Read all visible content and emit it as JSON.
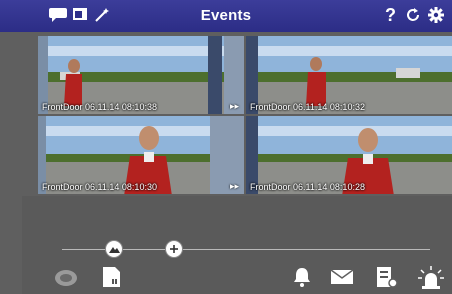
{
  "header": {
    "title": "Events",
    "left_icons": [
      "chat-bubble-icon",
      "window-icon",
      "magic-wand-icon"
    ],
    "right_icons": [
      "help-icon",
      "refresh-icon",
      "settings-gear-icon"
    ],
    "help_glyph": "?"
  },
  "events": [
    {
      "camera": "FrontDoor",
      "date": "06.11.14",
      "time": "08:10:38"
    },
    {
      "camera": "FrontDoor",
      "date": "06.11.14",
      "time": "08:10:32"
    },
    {
      "camera": "FrontDoor",
      "date": "06.11.14",
      "time": "08:10:30"
    },
    {
      "camera": "FrontDoor",
      "date": "06.11.14",
      "time": "08:10:28"
    }
  ],
  "timeline": {
    "controls": [
      "mountain-icon",
      "zoom-in-plus-icon"
    ]
  },
  "bottom_toolbar": {
    "icons": [
      "lens-icon",
      "sd-card-icon",
      "bell-icon",
      "mail-icon",
      "file-transfer-icon",
      "alarm-light-icon"
    ]
  },
  "colors": {
    "header": "#2e2f8a",
    "background": "#5f5f5f",
    "accent": "#ffffff"
  }
}
